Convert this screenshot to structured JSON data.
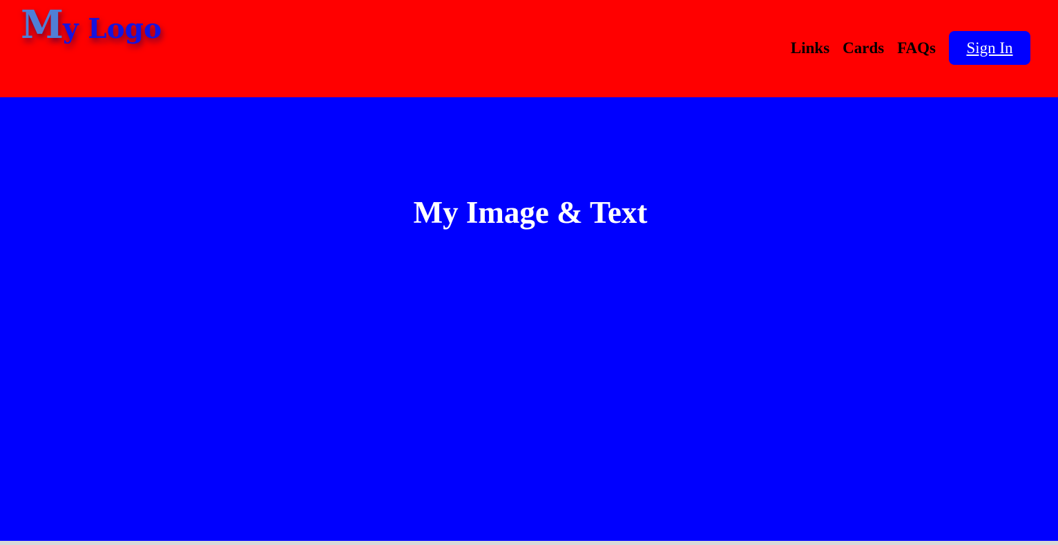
{
  "header": {
    "logo": {
      "first_letter": "M",
      "rest": "y Logo"
    },
    "nav": {
      "links": [
        "Links",
        "Cards",
        "FAQs"
      ],
      "sign_in_label": "Sign In"
    }
  },
  "hero": {
    "title": "My Image & Text"
  },
  "colors": {
    "header_background": "#ff0000",
    "hero_background": "#0000ff",
    "sign_in_background": "#0000ff",
    "logo_first_letter": "#4f7fd6",
    "logo_text": "#1414e0",
    "hero_title": "#ffffff"
  }
}
